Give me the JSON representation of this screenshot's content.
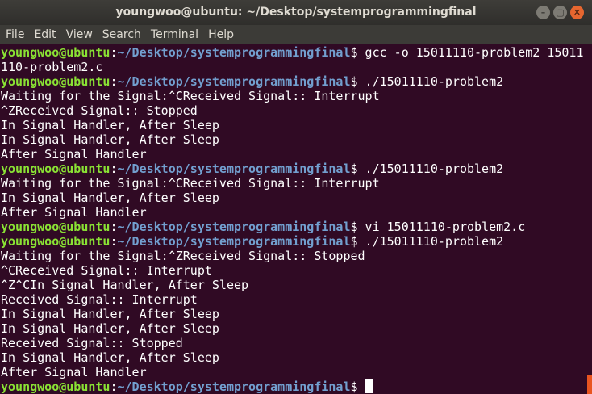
{
  "window": {
    "title": "youngwoo@ubuntu: ~/Desktop/systemprogrammingfinal",
    "controls": {
      "minimize": "–",
      "maximize": "▢",
      "close": "✕"
    }
  },
  "menu": [
    "File",
    "Edit",
    "View",
    "Search",
    "Terminal",
    "Help"
  ],
  "prompt": {
    "user": "youngwoo@ubuntu",
    "sep": ":",
    "path": "~/Desktop/systemprogrammingfinal",
    "symbol": "$"
  },
  "lines": [
    {
      "type": "prompt",
      "cmd": " gcc -o 15011110-problem2 15011"
    },
    {
      "type": "out",
      "text": "110-problem2.c"
    },
    {
      "type": "prompt",
      "cmd": " ./15011110-problem2"
    },
    {
      "type": "out",
      "text": "Waiting for the Signal:^CReceived Signal:: Interrupt"
    },
    {
      "type": "out",
      "text": "^ZReceived Signal:: Stopped"
    },
    {
      "type": "out",
      "text": "In Signal Handler, After Sleep"
    },
    {
      "type": "out",
      "text": "In Signal Handler, After Sleep"
    },
    {
      "type": "out",
      "text": "After Signal Handler"
    },
    {
      "type": "prompt",
      "cmd": " ./15011110-problem2"
    },
    {
      "type": "out",
      "text": "Waiting for the Signal:^CReceived Signal:: Interrupt"
    },
    {
      "type": "out",
      "text": "In Signal Handler, After Sleep"
    },
    {
      "type": "out",
      "text": "After Signal Handler"
    },
    {
      "type": "prompt",
      "cmd": " vi 15011110-problem2.c"
    },
    {
      "type": "prompt",
      "cmd": " ./15011110-problem2"
    },
    {
      "type": "out",
      "text": "Waiting for the Signal:^ZReceived Signal:: Stopped"
    },
    {
      "type": "out",
      "text": "^CReceived Signal:: Interrupt"
    },
    {
      "type": "out",
      "text": "^Z^CIn Signal Handler, After Sleep"
    },
    {
      "type": "out",
      "text": "Received Signal:: Interrupt"
    },
    {
      "type": "out",
      "text": "In Signal Handler, After Sleep"
    },
    {
      "type": "out",
      "text": "In Signal Handler, After Sleep"
    },
    {
      "type": "out",
      "text": "Received Signal:: Stopped"
    },
    {
      "type": "out",
      "text": "In Signal Handler, After Sleep"
    },
    {
      "type": "out",
      "text": "After Signal Handler"
    },
    {
      "type": "prompt",
      "cmd": " ",
      "cursor": true
    }
  ],
  "colors": {
    "background": "#300a24",
    "user": "#8ae234",
    "path": "#729fcf",
    "text": "#ffffff",
    "accent": "#e95420"
  }
}
